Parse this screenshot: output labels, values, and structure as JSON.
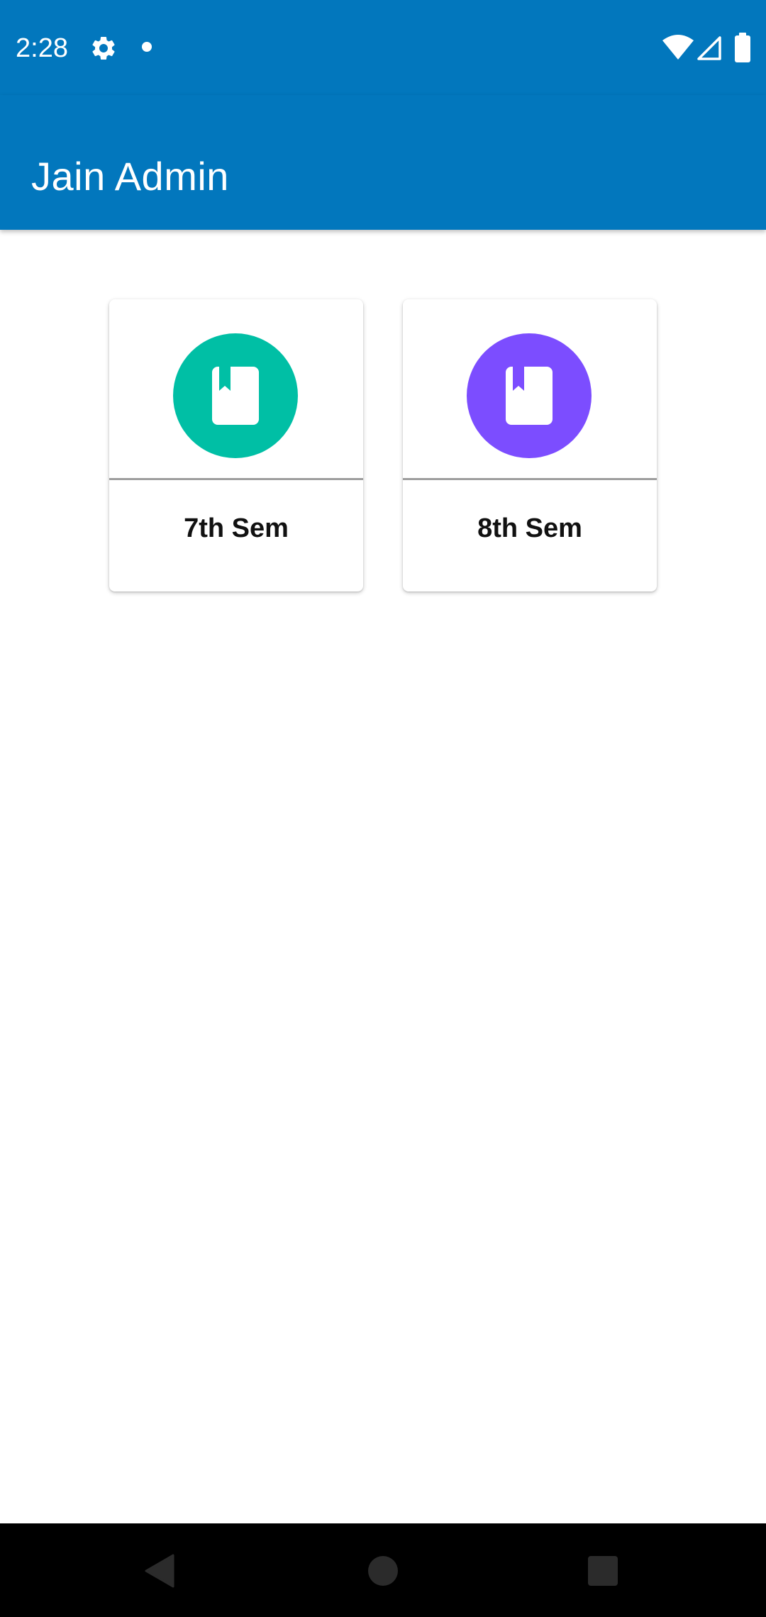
{
  "status_bar": {
    "time": "2:28",
    "icons": [
      "gear-icon",
      "notification-dot-icon",
      "wifi-icon",
      "signal-icon",
      "battery-icon"
    ]
  },
  "app_bar": {
    "title": "Jain Admin",
    "color": "#0277bd"
  },
  "cards": [
    {
      "label": "7th Sem",
      "icon": "book-icon",
      "color": "#00bfa5"
    },
    {
      "label": "8th Sem",
      "icon": "book-icon",
      "color": "#7c4dff"
    }
  ],
  "nav_bar": {
    "buttons": [
      "back-icon",
      "home-icon",
      "recents-icon"
    ]
  }
}
